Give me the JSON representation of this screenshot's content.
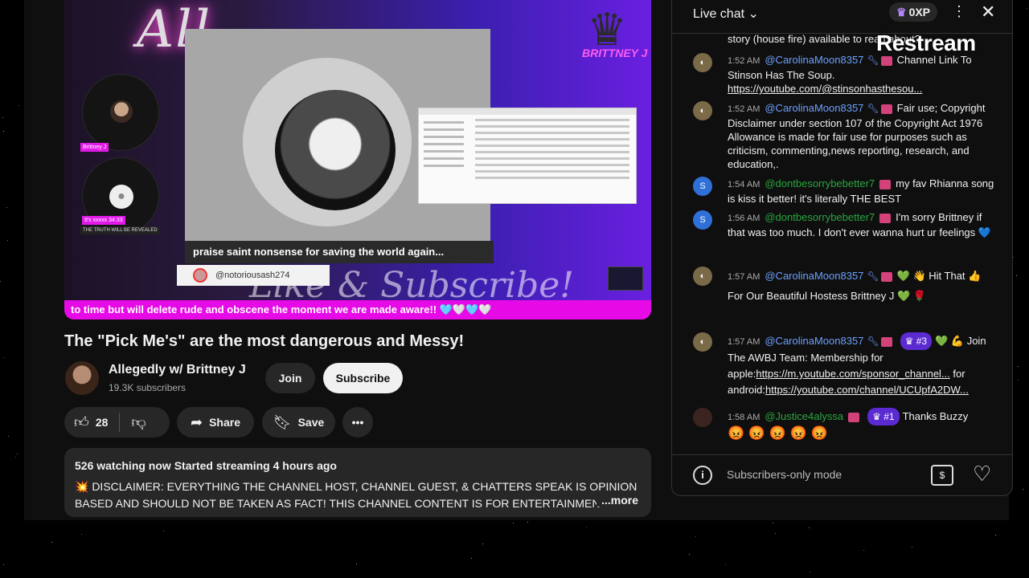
{
  "video": {
    "neon_title": "All",
    "brand_tag": "BRITTNEY J",
    "caption": "praise saint nonsense for saving the world again...",
    "handle": "@notoriousash274",
    "bg_script": "Like & Subscribe!",
    "ticker": "to time but will delete rude and obscene the moment we are made aware!! 🩵🤍🩵🤍",
    "mini_tag_1": "Brittney J",
    "mini_tag_2": "It's xxxxx 34:33",
    "mini_dark": "THE TRUTH WILL BE REVEALED"
  },
  "title": "The \"Pick Me's\" are the most dangerous and Messy!",
  "channel": {
    "name": "Allegedly w/ Brittney J",
    "subscribers": "19.3K subscribers"
  },
  "actions": {
    "join": "Join",
    "subscribe": "Subscribe",
    "likes": "28",
    "share": "Share",
    "save": "Save"
  },
  "description": {
    "meta": "526 watching now  Started streaming 4 hours ago",
    "line1": "💥 DISCLAIMER: EVERYTHING THE CHANNEL HOST, CHANNEL GUEST, & CHATTERS SPEAK IS OPINION",
    "line2": "BASED AND SHOULD NOT BE TAKEN AS FACT!  THIS CHANNEL CONTENT IS FOR ENTERTAINMEN",
    "more": "...more"
  },
  "chat": {
    "title": "Live chat",
    "xp": "0XP",
    "watermark": "Restream",
    "messages": [
      {
        "text": "story (house fire) available to read about?"
      },
      {
        "time": "1:52 AM",
        "author": "@CarolinaMoon8357",
        "text": "Channel Link To Stinson Has The Soup. ",
        "link": "https://youtube.com/@stinsonhasthesou..."
      },
      {
        "time": "1:52 AM",
        "author": "@CarolinaMoon8357",
        "text": "Fair use; Copyright Disclaimer under section 107 of the Copyright Act 1976 Allowance is made for fair use for purposes such as criticism, commenting,news reporting, research, and education,."
      },
      {
        "time": "1:54 AM",
        "author": "@dontbesorrybebetter7",
        "text": "my fav Rhianna song is kiss it better! it's literally THE BEST"
      },
      {
        "time": "1:56 AM",
        "author": "@dontbesorrybebetter7",
        "text": "I'm sorry Brittney if that was too much. I don't ever wanna hurt ur feelings 💙"
      },
      {
        "time": "1:57 AM",
        "author": "@CarolinaMoon8357",
        "text": "💚 👋 Hit That 👍 For Our Beautiful Hostess Brittney J 💚 🌹"
      },
      {
        "time": "1:57 AM",
        "author": "@CarolinaMoon8357",
        "tier": "#3",
        "text": "💚 💪 Join The AWBJ Team: Membership for apple:",
        "link": "https://m.youtube.com/sponsor_channel...",
        "text2": " for android:",
        "link2": "https://youtube.com/channel/UCUpfA2DW..."
      },
      {
        "time": "1:58 AM",
        "author": "@Justice4alyssa",
        "tier": "#1",
        "text": "Thanks Buzzy",
        "emojis": "😡 😡 😡 😡 😡"
      }
    ],
    "footer_mode": "Subscribers-only mode"
  }
}
